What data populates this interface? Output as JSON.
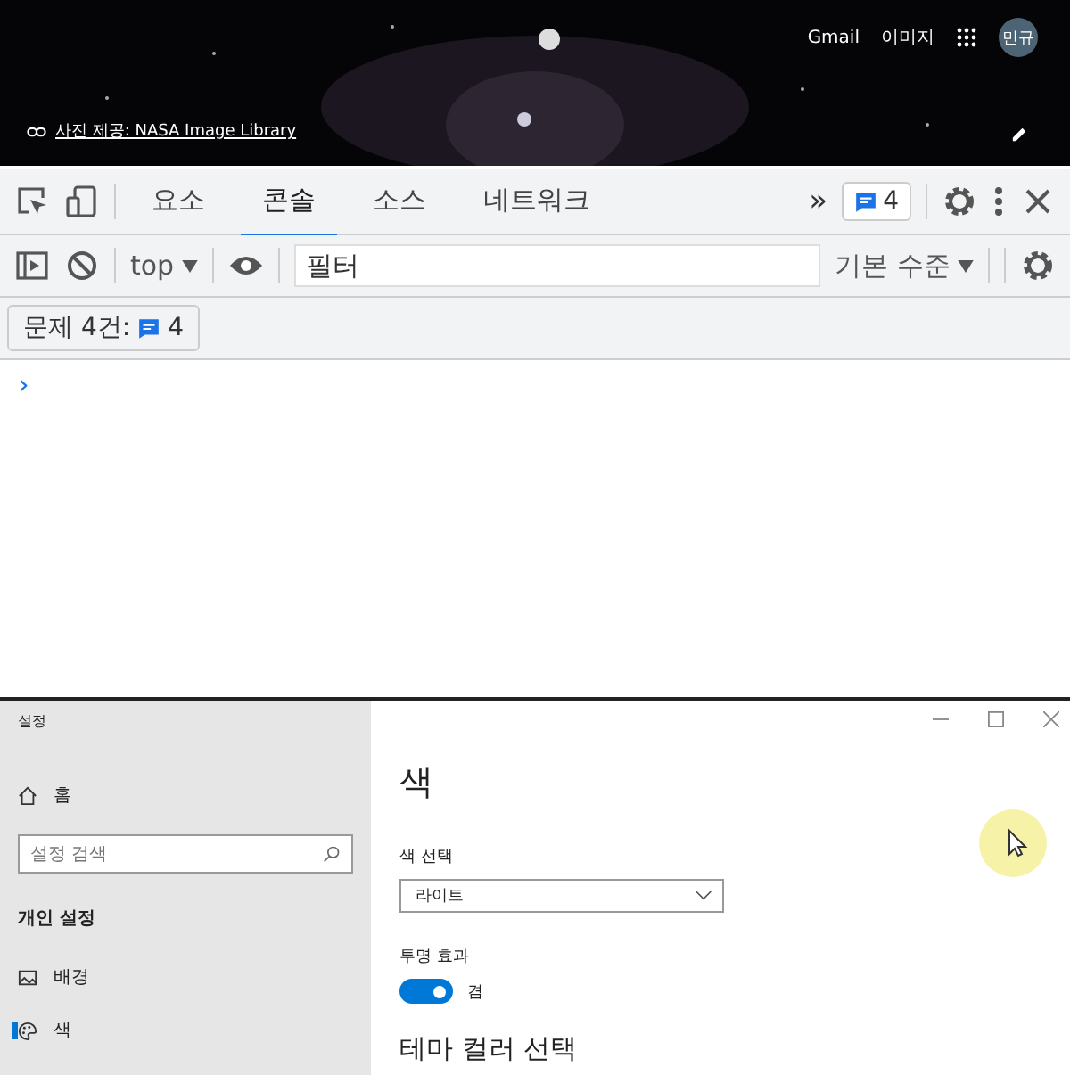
{
  "background": {
    "links": [
      "Gmail",
      "이미지"
    ],
    "avatar": "민규",
    "photo_credit": "사진 제공: NASA Image Library"
  },
  "devtools": {
    "tabs": [
      {
        "label": "요소",
        "selected": false
      },
      {
        "label": "콘솔",
        "selected": true
      },
      {
        "label": "소스",
        "selected": false
      },
      {
        "label": "네트워크",
        "selected": false
      }
    ],
    "more": "»",
    "issues_badge": "4",
    "context": "top",
    "filter": {
      "placeholder": "필터"
    },
    "level_menu": "기본 수준",
    "issues_button": {
      "label": "문제 4건:",
      "count": "4"
    },
    "prompt": "›"
  },
  "settings": {
    "title": "설정",
    "home": "홈",
    "search": {
      "placeholder": "설정 검색"
    },
    "section": "개인 설정",
    "nav": [
      {
        "label": "배경",
        "kind": "background",
        "selected": false
      },
      {
        "label": "색",
        "kind": "color",
        "selected": true
      }
    ],
    "page_title": "색",
    "color_choice": {
      "label": "색 선택",
      "value": "라이트"
    },
    "transparency": {
      "label": "투명 효과",
      "on": true,
      "state_text": "켬"
    },
    "theme_heading": "테마 컬러 선택"
  }
}
